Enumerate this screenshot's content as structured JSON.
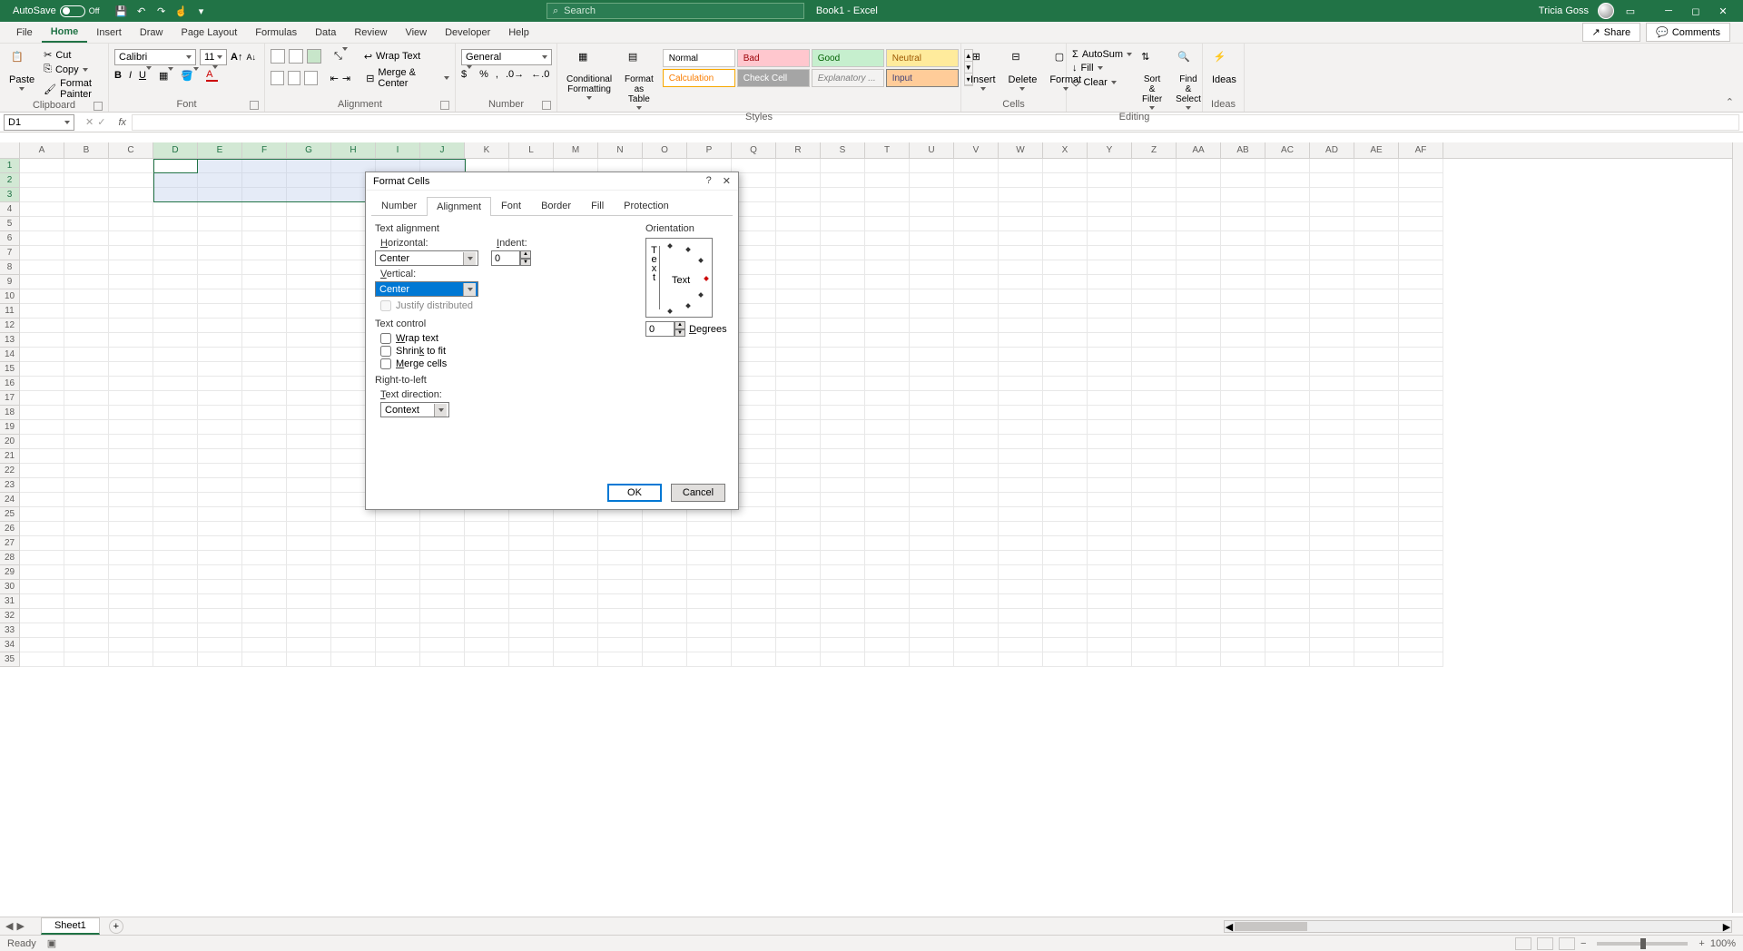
{
  "titleBar": {
    "autosave": "AutoSave",
    "autosaveState": "Off",
    "docTitle": "Book1 - Excel",
    "searchPlaceholder": "Search",
    "userName": "Tricia Goss"
  },
  "tabs": {
    "file": "File",
    "home": "Home",
    "insert": "Insert",
    "draw": "Draw",
    "pageLayout": "Page Layout",
    "formulas": "Formulas",
    "data": "Data",
    "review": "Review",
    "view": "View",
    "developer": "Developer",
    "help": "Help",
    "share": "Share",
    "comments": "Comments"
  },
  "ribbon": {
    "clipboard": {
      "paste": "Paste",
      "cut": "Cut",
      "copy": "Copy",
      "formatPainter": "Format Painter",
      "label": "Clipboard"
    },
    "font": {
      "name": "Calibri",
      "size": "11",
      "label": "Font"
    },
    "alignment": {
      "wrapText": "Wrap Text",
      "mergeCenter": "Merge & Center",
      "label": "Alignment"
    },
    "number": {
      "format": "General",
      "label": "Number"
    },
    "styles": {
      "condFmt": "Conditional Formatting",
      "fmtTable": "Format as Table",
      "label": "Styles",
      "gallery": {
        "normal": "Normal",
        "bad": "Bad",
        "good": "Good",
        "neutral": "Neutral",
        "calculation": "Calculation",
        "checkCell": "Check Cell",
        "explanatory": "Explanatory ...",
        "input": "Input"
      }
    },
    "cells": {
      "insert": "Insert",
      "delete": "Delete",
      "format": "Format",
      "label": "Cells"
    },
    "editing": {
      "autoSum": "AutoSum",
      "fill": "Fill",
      "clear": "Clear",
      "sortFilter": "Sort & Filter",
      "findSelect": "Find & Select",
      "label": "Editing"
    },
    "ideas": {
      "ideas": "Ideas",
      "label": "Ideas"
    }
  },
  "nameBox": "D1",
  "columns": [
    "A",
    "B",
    "C",
    "D",
    "E",
    "F",
    "G",
    "H",
    "I",
    "J",
    "K",
    "L",
    "M",
    "N",
    "O",
    "P",
    "Q",
    "R",
    "S",
    "T",
    "U",
    "V",
    "W",
    "X",
    "Y",
    "Z",
    "AA",
    "AB",
    "AC",
    "AD",
    "AE",
    "AF"
  ],
  "selectedCols": [
    "D",
    "E",
    "F",
    "G",
    "H",
    "I",
    "J"
  ],
  "selectedRows": [
    1,
    2,
    3
  ],
  "rowCount": 35,
  "sheetTab": "Sheet1",
  "statusBar": {
    "state": "Ready",
    "zoom": "100%"
  },
  "dialog": {
    "title": "Format Cells",
    "tabs": {
      "number": "Number",
      "alignment": "Alignment",
      "font": "Font",
      "border": "Border",
      "fill": "Fill",
      "protection": "Protection"
    },
    "sections": {
      "textAlignment": "Text alignment",
      "horizontal": "Horizontal:",
      "horizontalValue": "Center",
      "vertical": "Vertical:",
      "verticalValue": "Center",
      "indent": "Indent:",
      "indentValue": "0",
      "justifyDistributed": "Justify distributed",
      "textControl": "Text control",
      "wrapText": "Wrap text",
      "shrinkToFit": "Shrink to fit",
      "mergeCells": "Merge cells",
      "rightToLeft": "Right-to-left",
      "textDirection": "Text direction:",
      "textDirectionValue": "Context",
      "orientation": "Orientation",
      "orientationText": "Text",
      "degrees": "Degrees",
      "degreesValue": "0"
    },
    "buttons": {
      "ok": "OK",
      "cancel": "Cancel"
    }
  }
}
